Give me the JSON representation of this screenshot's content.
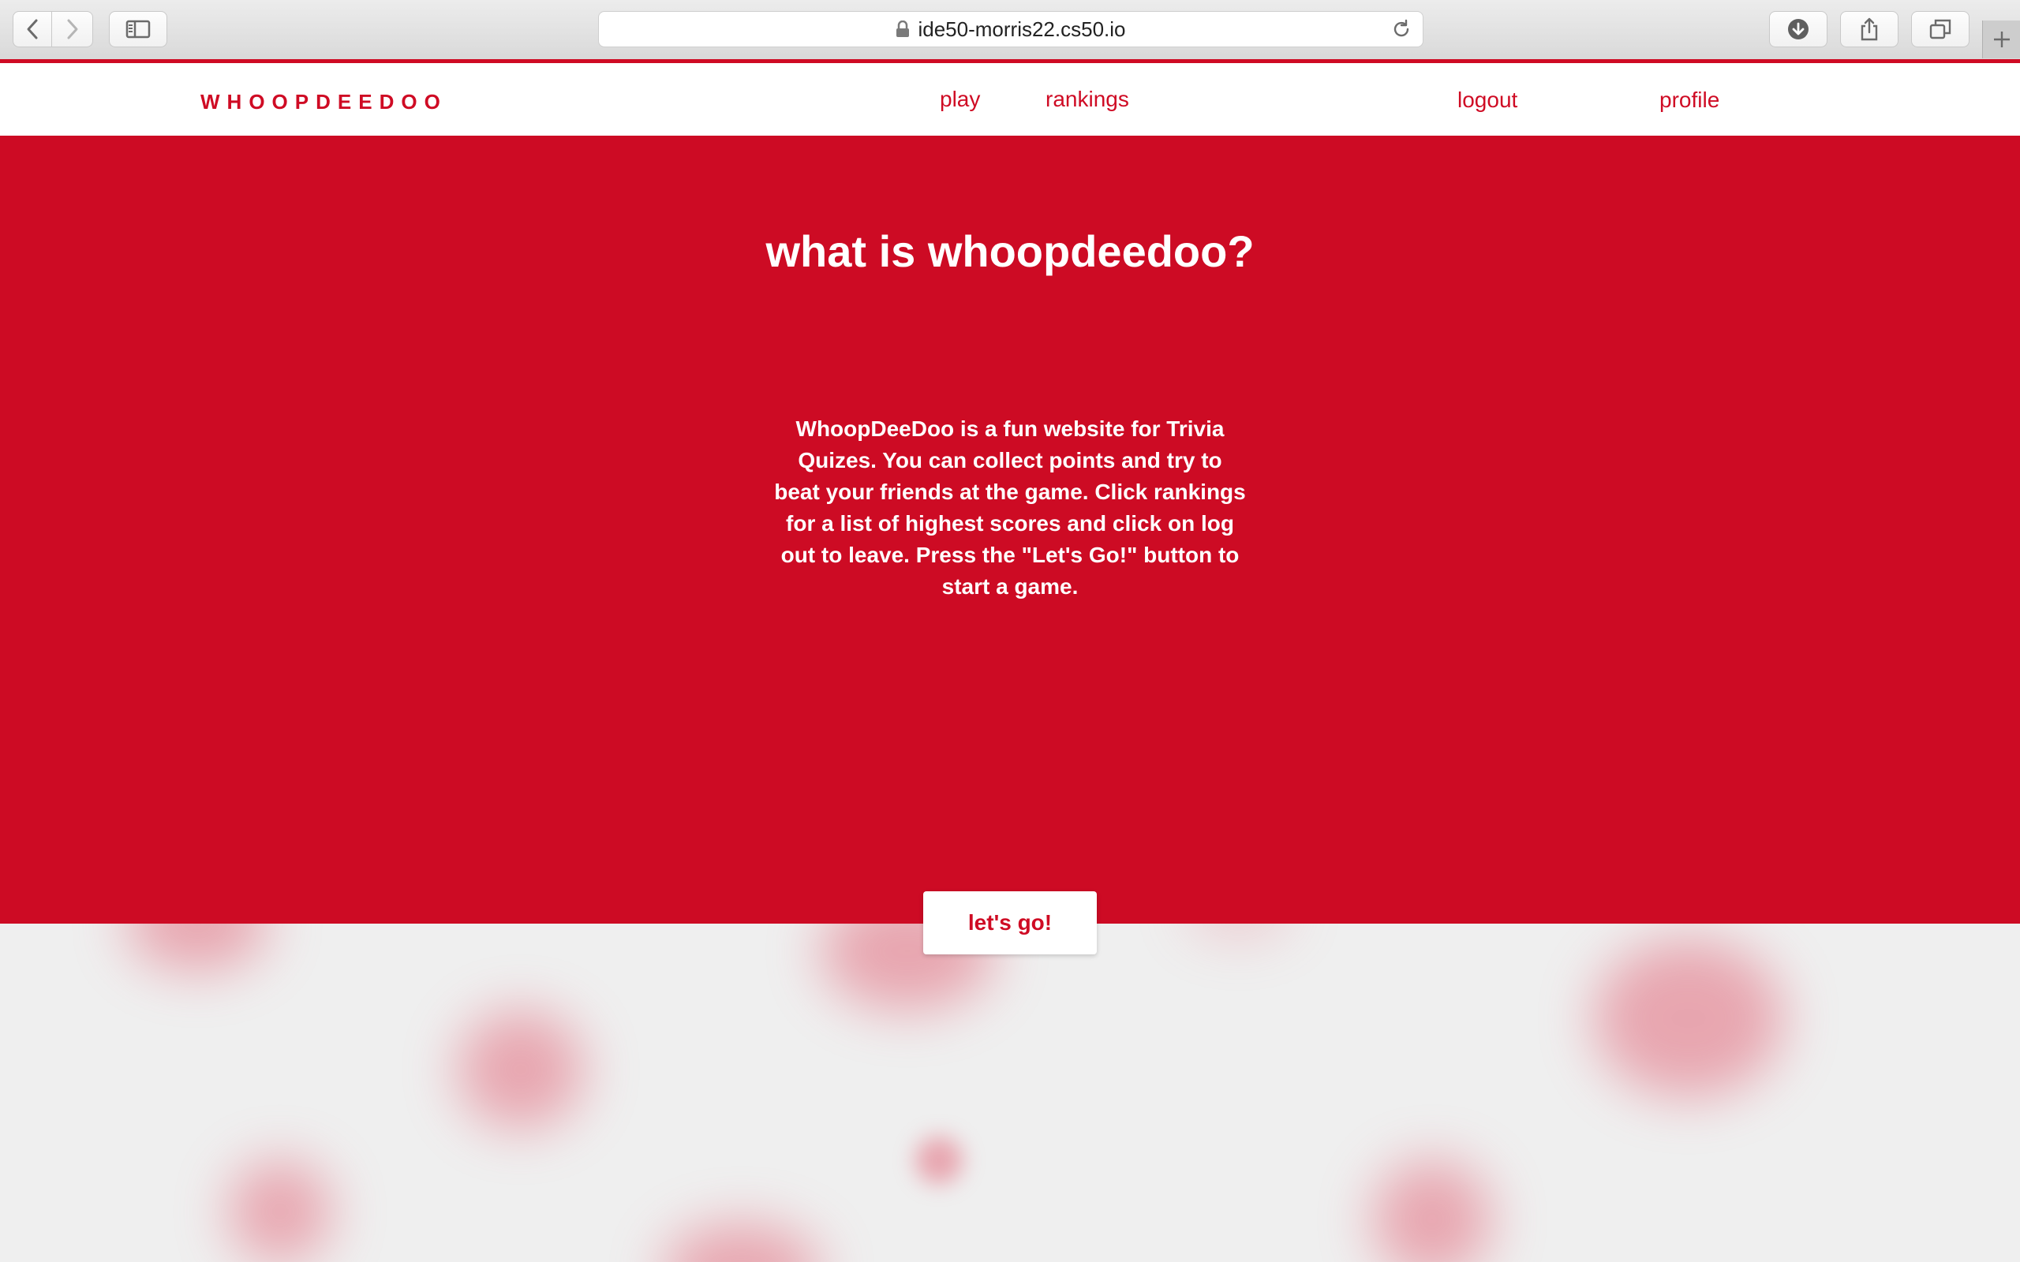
{
  "browser": {
    "url": "ide50-morris22.cs50.io"
  },
  "nav": {
    "brand": "WHOOPDEEDOO",
    "play": "play",
    "rankings": "rankings",
    "logout": "logout",
    "profile": "profile"
  },
  "hero": {
    "title": "what is whoopdeedoo?",
    "description": "WhoopDeeDoo is a fun website for Trivia Quizes. You can collect points and try to beat your friends at the game. Click rankings for a list of highest scores and click on log out to leave. Press the \"Let's Go!\" button to start a game.",
    "cta": "let's go!"
  },
  "colors": {
    "brand_red": "#cd0b24",
    "background": "#efefef",
    "white": "#ffffff"
  }
}
